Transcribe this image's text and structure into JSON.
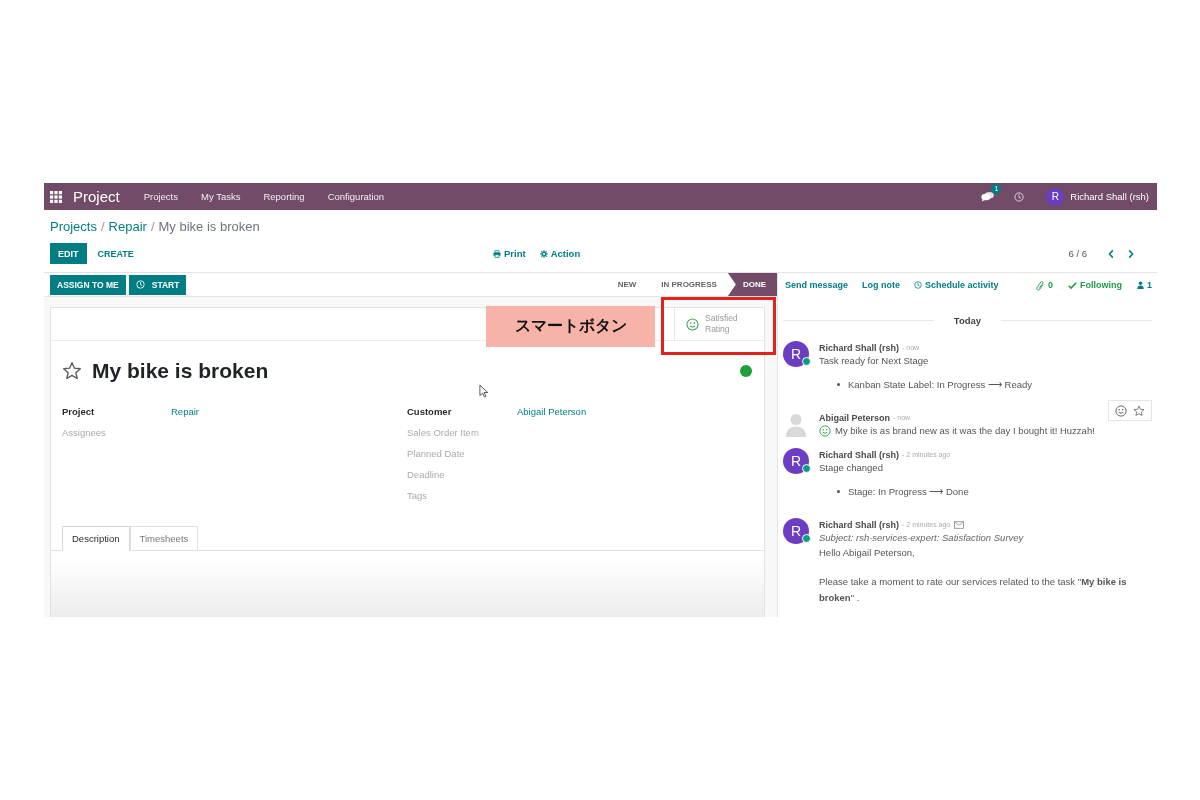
{
  "navbar": {
    "app_name": "Project",
    "menu": [
      {
        "label": "Projects"
      },
      {
        "label": "My Tasks"
      },
      {
        "label": "Reporting"
      },
      {
        "label": "Configuration"
      }
    ],
    "messages_badge": "1",
    "user": {
      "initial": "R",
      "name": "Richard Shall (rsh)"
    }
  },
  "breadcrumb": [
    {
      "label": "Projects",
      "kind": "link"
    },
    {
      "label": "/",
      "kind": "separator"
    },
    {
      "label": "Repair",
      "kind": "link"
    },
    {
      "label": "/",
      "kind": "separator"
    },
    {
      "label": "My bike is broken",
      "kind": "current"
    }
  ],
  "control_panel": {
    "buttons": [
      {
        "label": "EDIT",
        "kind": "primary"
      },
      {
        "label": "CREATE",
        "kind": "secondary"
      }
    ],
    "actions": [
      {
        "label": "Print",
        "kind": "print"
      },
      {
        "label": "Action",
        "kind": "action"
      }
    ],
    "pager": "6 / 6"
  },
  "header_buttons": [
    {
      "label": "ASSIGN TO ME",
      "kind": "plain"
    },
    {
      "label": "START",
      "kind": "timer"
    }
  ],
  "stages": [
    {
      "label": "NEW",
      "selected": false
    },
    {
      "label": "IN PROGRESS",
      "selected": false
    },
    {
      "label": "DONE",
      "selected": true
    }
  ],
  "smart_button": {
    "value": "Satisfied",
    "label": "Rating"
  },
  "annotation": {
    "label": "スマートボタン"
  },
  "task": {
    "title": "My bike is broken",
    "starred": false,
    "ready": true
  },
  "fields_left": [
    {
      "label": "Project",
      "value": "Repair"
    },
    {
      "label": "Assignees"
    }
  ],
  "fields_right": [
    {
      "label": "Customer",
      "value": "Abigail Peterson"
    },
    {
      "label": "Sales Order Item"
    },
    {
      "label": "Planned Date"
    },
    {
      "label": "Deadline"
    },
    {
      "label": "Tags"
    }
  ],
  "tabs": [
    {
      "label": "Description",
      "selected": true
    },
    {
      "label": "Timesheets",
      "selected": false
    }
  ],
  "chatter": {
    "toolbar": [
      {
        "label": "Send message",
        "kind": "send"
      },
      {
        "label": "Log note",
        "kind": "log"
      },
      {
        "label": "Schedule activity",
        "kind": "activity"
      }
    ],
    "attachments": "0",
    "follow": {
      "label": "Following",
      "following": true
    },
    "followers": "1",
    "separator": "Today",
    "messages": [
      {
        "kind": "note",
        "author": "Richard Shall (rsh)",
        "avatar_initial": "R",
        "online": true,
        "time": "- now",
        "body": "Task ready for Next Stage",
        "changes": [
          "Kanban State Label: In Progress ⟶ Ready"
        ]
      },
      {
        "kind": "rating",
        "author": "Abigail Peterson",
        "time": "- now",
        "body": "My bike is as brand new as it was the day I bought it! Huzzah!",
        "hovered": true
      },
      {
        "kind": "note",
        "author": "Richard Shall (rsh)",
        "avatar_initial": "R",
        "online": true,
        "time": "- 2 minutes ago",
        "body": "Stage changed",
        "changes": [
          "Stage: In Progress ⟶ Done"
        ]
      },
      {
        "kind": "email",
        "author": "Richard Shall (rsh)",
        "avatar_initial": "R",
        "online": true,
        "time": "- 2 minutes ago",
        "subject": "Subject: rsh-services-expert: Satisfaction Survey",
        "paragraphs": [
          "Hello Abigail Peterson,",
          "Please take a moment to rate our services related to the task \"**My bike is broken**\" ."
        ]
      }
    ]
  }
}
